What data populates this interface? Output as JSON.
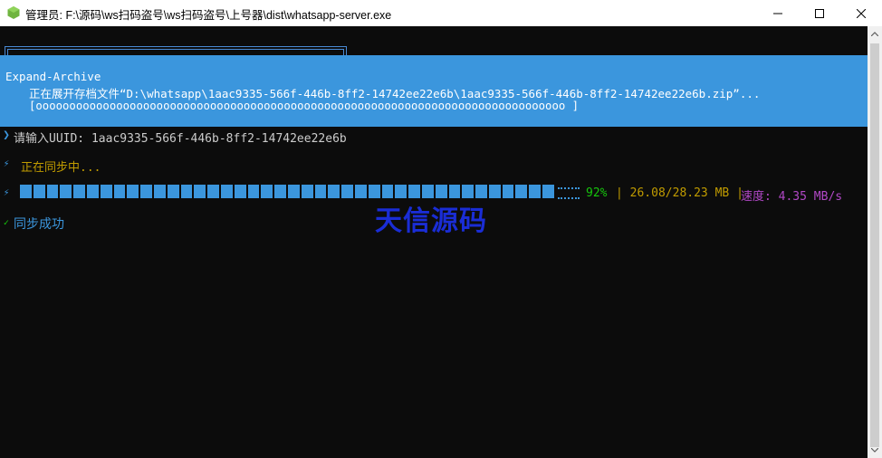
{
  "window": {
    "title": "管理员: F:\\源码\\ws扫码盗号\\ws扫码盗号\\上号器\\dist\\whatsapp-server.exe"
  },
  "banner": {
    "title": "Expand-Archive",
    "status": "正在展开存档文件“D:\\whatsapp\\1aac9335-566f-446b-8ff2-14742ee22e6b\\1aac9335-566f-446b-8ff2-14742ee22e6b.zip”...",
    "bar": "[ooooooooooooooooooooooooooooooooooooooooooooooooooooooooooooooooooooooooooooooo                    ]"
  },
  "console": {
    "line1_icon": "❯",
    "line1": "请输入UUID: 1aac9335-566f-446b-8ff2-14742ee22e6b",
    "line2_icon": "⚡",
    "line2": "正在同步中...",
    "line3_icon": "⚡",
    "progress": {
      "fraction": 0.92,
      "percent_text": "92%",
      "size_text": "26.08/28.23 MB",
      "speed_text": "速度: 4.35 MB/s"
    },
    "line4_icon": "✓",
    "line4": "同步成功"
  },
  "watermark": "天信源码",
  "colors": {
    "accent": "#3b96dd",
    "yellow": "#c19c00",
    "green": "#16c60c",
    "purple": "#b148c6",
    "watermark": "#1a2dd6"
  }
}
